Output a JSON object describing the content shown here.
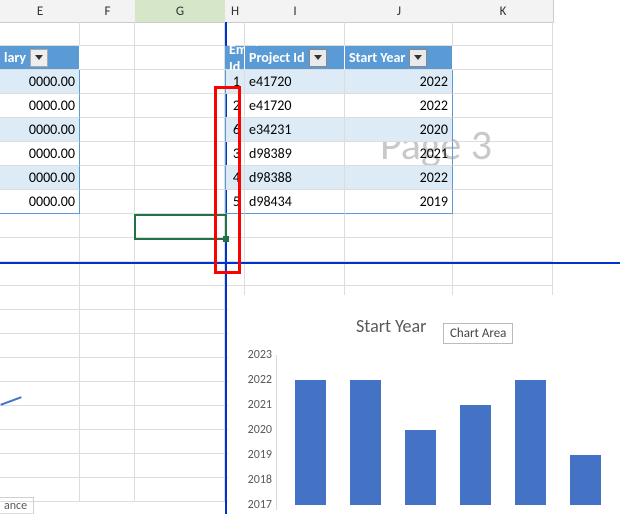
{
  "cols": [
    "E",
    "F",
    "G",
    "H",
    "I",
    "J",
    "K"
  ],
  "selected_col_index": 2,
  "watermark": "Page 3",
  "salary_table": {
    "header_partial": "lary",
    "values": [
      "0000.00",
      "0000.00",
      "0000.00",
      "0000.00",
      "0000.00",
      "0000.00"
    ]
  },
  "projects_table": {
    "headers": [
      "Employee Id",
      "Project Id",
      "Start Year"
    ],
    "rows": [
      {
        "emp": 1,
        "proj": "e41720",
        "year": 2022
      },
      {
        "emp": 2,
        "proj": "e41720",
        "year": 2022
      },
      {
        "emp": 6,
        "proj": "e34231",
        "year": 2020
      },
      {
        "emp": 3,
        "proj": "d98389",
        "year": 2021
      },
      {
        "emp": 4,
        "proj": "d98388",
        "year": 2022
      },
      {
        "emp": 5,
        "proj": "d98434",
        "year": 2019
      }
    ]
  },
  "chart_tooltip": "Chart Area",
  "legend_fragment": "ance",
  "chart_data": {
    "type": "bar",
    "title": "Start Year",
    "ylim": [
      2017,
      2023
    ],
    "yticks": [
      2017,
      2018,
      2019,
      2020,
      2021,
      2022,
      2023
    ],
    "values": [
      2022,
      2022,
      2020,
      2021,
      2022,
      2019
    ]
  }
}
